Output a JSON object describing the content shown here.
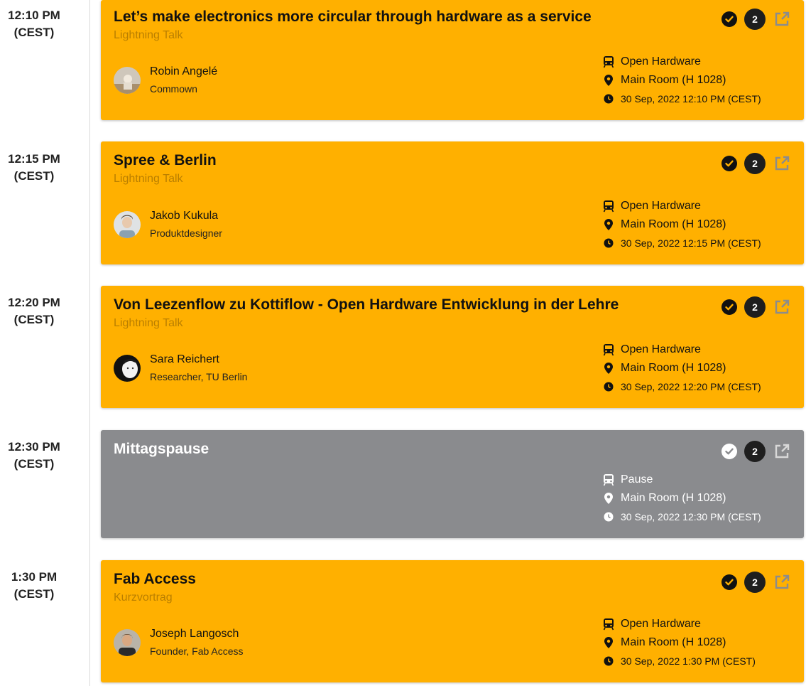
{
  "colors": {
    "talk": "#ffb000",
    "break": "#8a8b8e",
    "dark": "#111111"
  },
  "sessions": [
    {
      "time": "12:10 PM",
      "tz": "(CEST)",
      "title": "Let’s make electronics more circular through hardware as a service",
      "subtitle": "Lightning Talk",
      "speaker": {
        "name": "Robin Angelé",
        "role": "Commown"
      },
      "track": "Open Hardware",
      "room": "Main Room (H 1028)",
      "datetime": "30 Sep, 2022 12:10 PM (CEST)",
      "count": "2"
    },
    {
      "time": "12:15 PM",
      "tz": "(CEST)",
      "title": "Spree & Berlin",
      "subtitle": "Lightning Talk",
      "speaker": {
        "name": "Jakob Kukula",
        "role": "Produktdesigner"
      },
      "track": "Open Hardware",
      "room": "Main Room (H 1028)",
      "datetime": "30 Sep, 2022 12:15 PM (CEST)",
      "count": "2"
    },
    {
      "time": "12:20 PM",
      "tz": "(CEST)",
      "title": "Von Leezenflow zu Kottiflow - Open Hardware Entwicklung in der Lehre",
      "subtitle": "Lightning Talk",
      "speaker": {
        "name": "Sara Reichert",
        "role": "Researcher, TU Berlin"
      },
      "track": "Open Hardware",
      "room": "Main Room (H 1028)",
      "datetime": "30 Sep, 2022 12:20 PM (CEST)",
      "count": "2"
    },
    {
      "time": "12:30 PM",
      "tz": "(CEST)",
      "title": "Mittagspause",
      "track": "Pause",
      "room": "Main Room (H 1028)",
      "datetime": "30 Sep, 2022 12:30 PM (CEST)",
      "count": "2"
    },
    {
      "time": "1:30 PM",
      "tz": "(CEST)",
      "title": "Fab Access",
      "subtitle": "Kurzvortrag",
      "speaker": {
        "name": "Joseph Langosch",
        "role": "Founder, Fab Access"
      },
      "track": "Open Hardware",
      "room": "Main Room (H 1028)",
      "datetime": "30 Sep, 2022 1:30 PM (CEST)",
      "count": "2"
    }
  ]
}
